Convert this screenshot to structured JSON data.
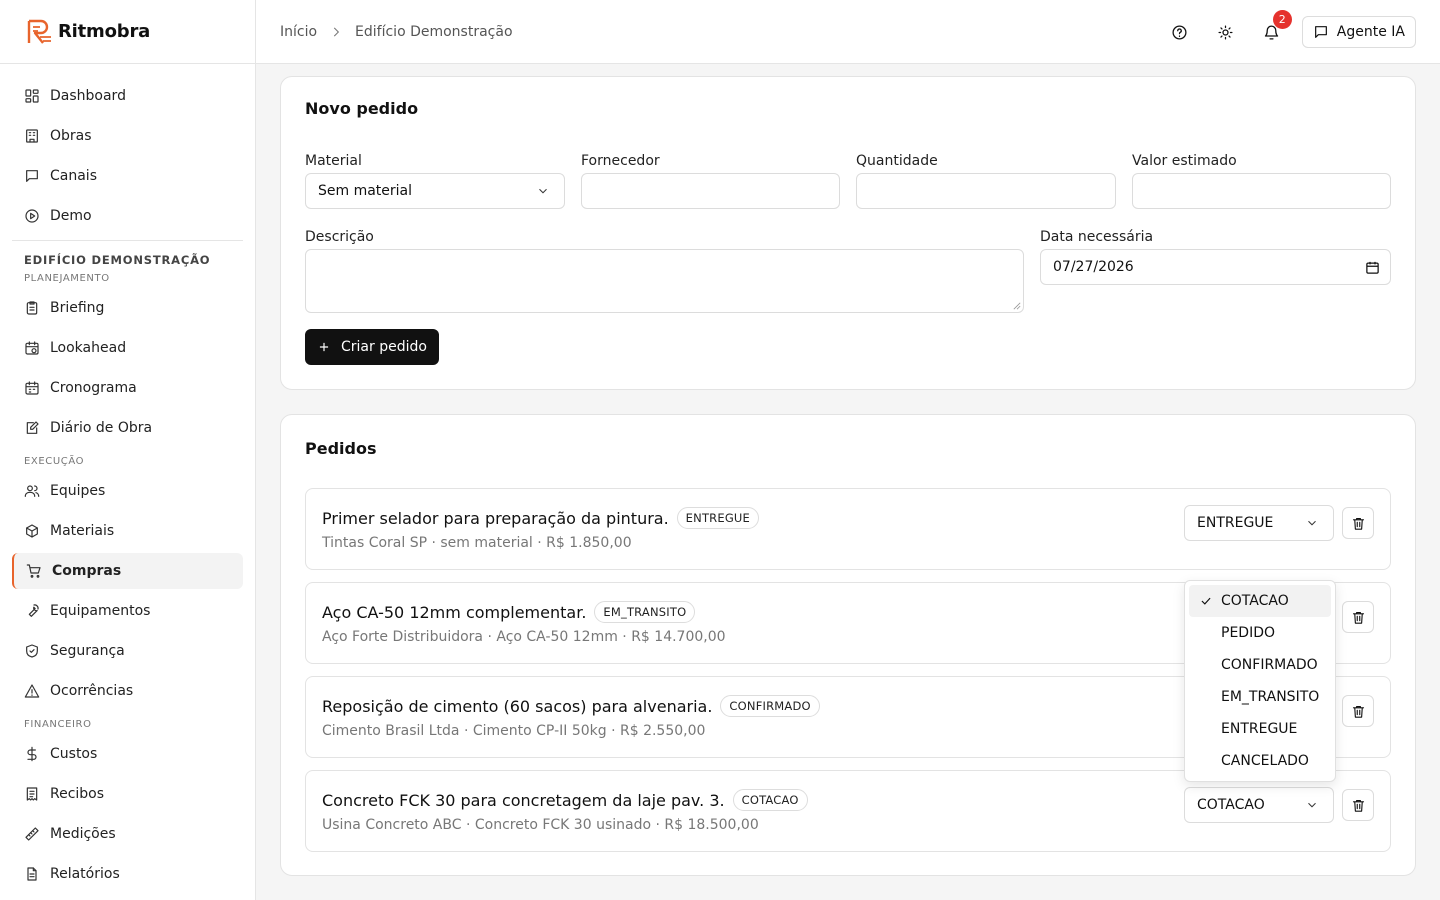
{
  "app": {
    "name": "Ritmobra",
    "brand_color": "#e8642c"
  },
  "sidebar": {
    "top_items": [
      {
        "label": "Dashboard",
        "icon": "grid-icon"
      },
      {
        "label": "Obras",
        "icon": "building-icon"
      },
      {
        "label": "Canais",
        "icon": "message-icon"
      },
      {
        "label": "Demo",
        "icon": "play-icon"
      }
    ],
    "project_title": "EDIFÍCIO DEMONSTRAÇÃO",
    "sections": [
      {
        "title": "PLANEJAMENTO",
        "items": [
          {
            "label": "Briefing",
            "icon": "clipboard-icon"
          },
          {
            "label": "Lookahead",
            "icon": "calendar-clock-icon"
          },
          {
            "label": "Cronograma",
            "icon": "calendar-icon"
          },
          {
            "label": "Diário de Obra",
            "icon": "notebook-pen-icon"
          }
        ]
      },
      {
        "title": "EXECUÇÃO",
        "items": [
          {
            "label": "Equipes",
            "icon": "users-icon"
          },
          {
            "label": "Materiais",
            "icon": "package-icon"
          },
          {
            "label": "Compras",
            "icon": "cart-icon",
            "active": true
          },
          {
            "label": "Equipamentos",
            "icon": "wrench-icon"
          },
          {
            "label": "Segurança",
            "icon": "shield-icon"
          },
          {
            "label": "Ocorrências",
            "icon": "alert-triangle-icon"
          }
        ]
      },
      {
        "title": "FINANCEIRO",
        "items": [
          {
            "label": "Custos",
            "icon": "dollar-icon"
          },
          {
            "label": "Recibos",
            "icon": "receipt-icon"
          },
          {
            "label": "Medições",
            "icon": "ruler-icon"
          },
          {
            "label": "Relatórios",
            "icon": "file-text-icon"
          }
        ]
      }
    ]
  },
  "header": {
    "breadcrumb": [
      "Início",
      "Edifício Demonstração"
    ],
    "notification_count": "2",
    "agent_label": "Agente IA"
  },
  "new_order": {
    "title": "Novo pedido",
    "material_label": "Material",
    "material_value": "Sem material",
    "supplier_label": "Fornecedor",
    "supplier_value": "",
    "quantity_label": "Quantidade",
    "quantity_value": "",
    "estimate_label": "Valor estimado",
    "estimate_value": "",
    "description_label": "Descrição",
    "date_label": "Data necessária",
    "date_value": "07/27/2026",
    "create_label": "Criar pedido"
  },
  "orders": {
    "title": "Pedidos",
    "items": [
      {
        "title": "Primer selador para preparação da pintura.",
        "status": "ENTREGUE",
        "subtitle": "Tintas Coral SP · sem material · R$ 1.850,00",
        "select_value": "ENTREGUE"
      },
      {
        "title": "Aço CA-50 12mm complementar.",
        "status": "EM_TRANSITO",
        "subtitle": "Aço Forte Distribuidora · Aço CA-50 12mm · R$ 14.700,00",
        "select_value": "EM_TRANSITO"
      },
      {
        "title": "Reposição de cimento (60 sacos) para alvenaria.",
        "status": "CONFIRMADO",
        "subtitle": "Cimento Brasil Ltda · Cimento CP-II 50kg · R$ 2.550,00",
        "select_value": "CONFIRMADO"
      },
      {
        "title": "Concreto FCK 30 para concretagem da laje pav. 3.",
        "status": "COTACAO",
        "subtitle": "Usina Concreto ABC · Concreto FCK 30 usinado · R$ 18.500,00",
        "select_value": "COTACAO"
      }
    ]
  },
  "status_dropdown": {
    "selected": "COTACAO",
    "options": [
      "COTACAO",
      "PEDIDO",
      "CONFIRMADO",
      "EM_TRANSITO",
      "ENTREGUE",
      "CANCELADO"
    ]
  }
}
